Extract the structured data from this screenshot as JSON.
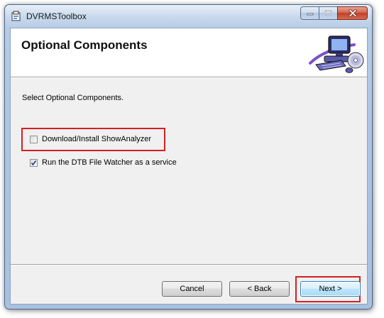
{
  "window": {
    "title": "DVRMSToolbox",
    "icon": "installer-package-icon"
  },
  "header": {
    "title": "Optional Components",
    "art_icon": "computer-with-cd-icon"
  },
  "body": {
    "instruction": "Select Optional Components.",
    "options": [
      {
        "label": "Download/Install ShowAnalyzer",
        "checked": false,
        "highlighted": true
      },
      {
        "label": "Run the DTB File Watcher as a service",
        "checked": true,
        "highlighted": false
      }
    ]
  },
  "buttons": {
    "cancel": "Cancel",
    "back": "< Back",
    "next": "Next >",
    "next_highlighted": true
  },
  "colors": {
    "highlight_box": "#d42020",
    "next_button_border": "#3c7fb1",
    "close_button": "#c2402a"
  }
}
